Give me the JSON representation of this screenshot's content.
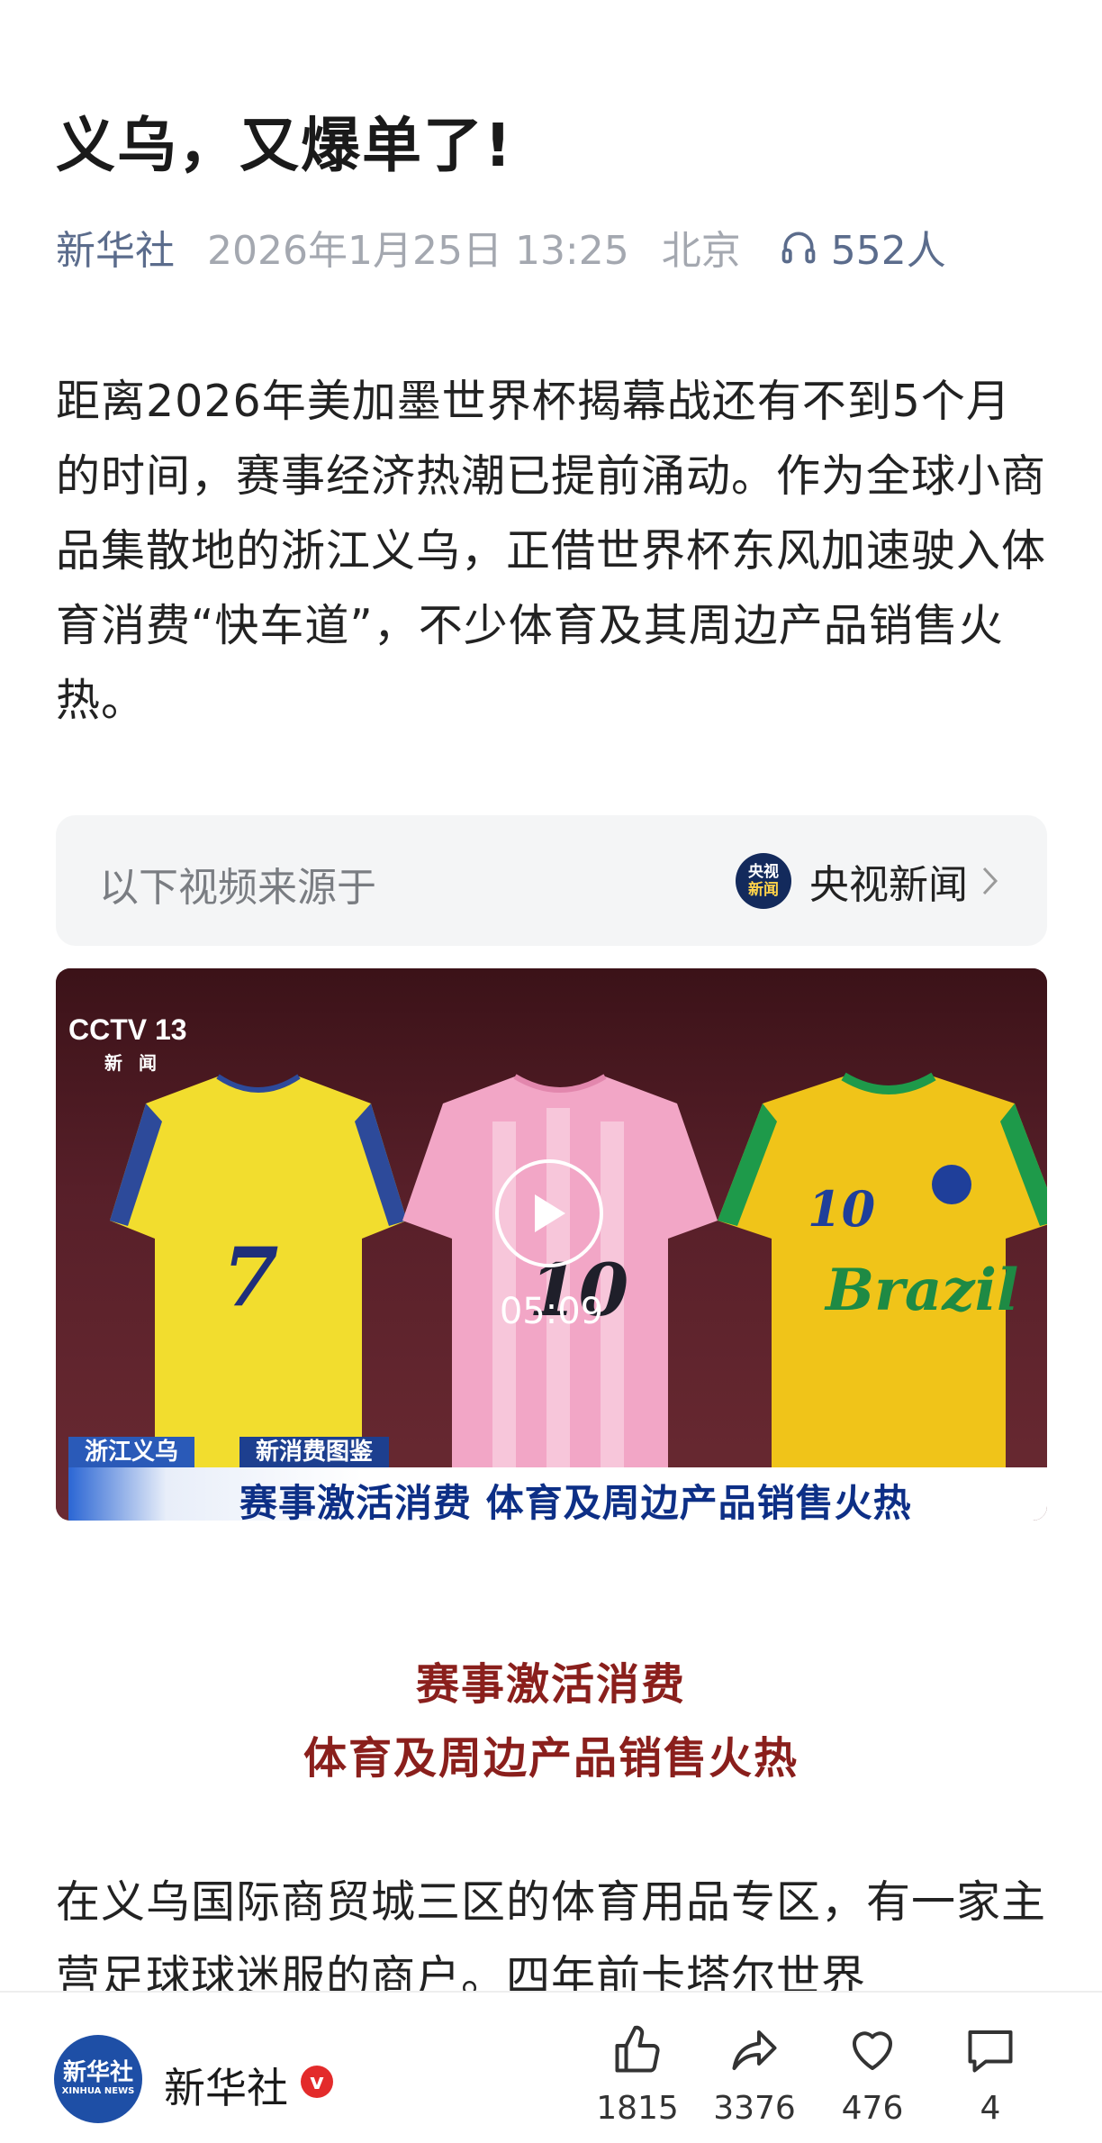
{
  "article": {
    "title": "义乌，又爆单了!",
    "source": "新华社",
    "date": "2026年1月25日 13:25",
    "location": "北京",
    "listeners": "552人",
    "paragraph1": "距离2026年美加墨世界杯揭幕战还有不到5个月的时间，赛事经济热潮已提前涌动。作为全球小商品集散地的浙江义乌，正借世界杯东风加速驶入体育消费“快车道”，不少体育及其周边产品销售火热。",
    "subhead1": "赛事激活消费",
    "subhead2": "体育及周边产品销售火热",
    "paragraph2": "在义乌国际商贸城三区的体育用品专区，有一家主营足球球迷服的商户。四年前卡塔尔世界"
  },
  "video_source": {
    "label": "以下视频来源于",
    "logo_line1": "央视",
    "logo_line2": "新闻",
    "name": "央视新闻"
  },
  "video": {
    "duration": "05:09",
    "cctv_logo": "CCTV 13",
    "cctv_sub": "新闻",
    "tag1": "浙江义乌",
    "tag2": "新消费图鉴",
    "headline": "赛事激活消费 体育及周边产品销售火热",
    "shirt_numbers": [
      "7",
      "10",
      "10"
    ],
    "shirt_text": "Brazil"
  },
  "bottom": {
    "avatar_line1": "新华社",
    "avatar_line2": "XINHUA NEWS",
    "author": "新华社",
    "badge": "v",
    "likes": "1815",
    "shares": "3376",
    "favorites": "476",
    "comments": "4"
  },
  "colors": {
    "meta_blue": "#5b6c8c",
    "meta_gray": "#a4a8b0",
    "subhead_red": "#8a1f1c",
    "badge_red": "#e32b2b"
  }
}
